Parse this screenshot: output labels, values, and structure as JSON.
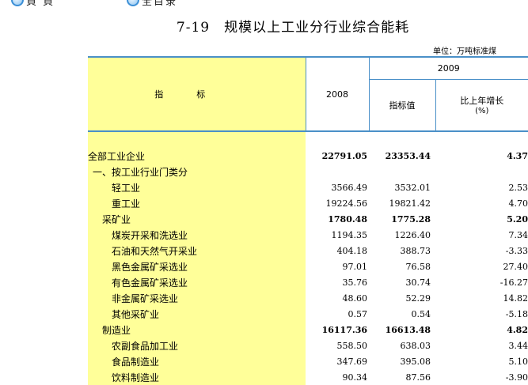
{
  "nav": {
    "left_label": "頁 頁",
    "right_label": "全目录"
  },
  "title": "7-19　规模以上工业分行业综合能耗",
  "unit": "单位：万吨标准煤",
  "header": {
    "indicator": "指标",
    "year_2008": "2008",
    "year_2009": "2009",
    "value_label": "指标值",
    "growth_label": "比上年增长",
    "growth_unit": "(%)"
  },
  "rows": [
    {
      "name": "全部工业企业",
      "v2008": "22791.05",
      "v2009": "23353.44",
      "growth": "4.37",
      "indent": 0,
      "bold": true
    },
    {
      "name": "一、按工业行业门类分",
      "v2008": "",
      "v2009": "",
      "growth": "",
      "indent": 1,
      "bold": false
    },
    {
      "name": "轻工业",
      "v2008": "3566.49",
      "v2009": "3532.01",
      "growth": "2.53",
      "indent": 2,
      "bold": false
    },
    {
      "name": "重工业",
      "v2008": "19224.56",
      "v2009": "19821.42",
      "growth": "4.70",
      "indent": 2,
      "bold": false
    },
    {
      "name": "采矿业",
      "v2008": "1780.48",
      "v2009": "1775.28",
      "growth": "5.20",
      "indent": 4,
      "bold": true
    },
    {
      "name": "煤炭开采和洗选业",
      "v2008": "1194.35",
      "v2009": "1226.40",
      "growth": "7.34",
      "indent": 3,
      "bold": false
    },
    {
      "name": "石油和天然气开采业",
      "v2008": "404.18",
      "v2009": "388.73",
      "growth": "-3.33",
      "indent": 3,
      "bold": false
    },
    {
      "name": "黑色金属矿采选业",
      "v2008": "97.01",
      "v2009": "76.58",
      "growth": "27.40",
      "indent": 3,
      "bold": false
    },
    {
      "name": "有色金属矿采选业",
      "v2008": "35.76",
      "v2009": "30.74",
      "growth": "-16.27",
      "indent": 3,
      "bold": false
    },
    {
      "name": "非金属矿采选业",
      "v2008": "48.60",
      "v2009": "52.29",
      "growth": "14.82",
      "indent": 3,
      "bold": false
    },
    {
      "name": "其他采矿业",
      "v2008": "0.57",
      "v2009": "0.54",
      "growth": "-5.18",
      "indent": 3,
      "bold": false
    },
    {
      "name": "制造业",
      "v2008": "16117.36",
      "v2009": "16613.48",
      "growth": "4.82",
      "indent": 4,
      "bold": true
    },
    {
      "name": "农副食品加工业",
      "v2008": "558.50",
      "v2009": "638.03",
      "growth": "3.44",
      "indent": 3,
      "bold": false
    },
    {
      "name": "食品制造业",
      "v2008": "347.69",
      "v2009": "395.08",
      "growth": "5.10",
      "indent": 3,
      "bold": false
    },
    {
      "name": "饮料制造业",
      "v2008": "90.34",
      "v2009": "87.56",
      "growth": "-3.90",
      "indent": 3,
      "bold": false
    }
  ]
}
